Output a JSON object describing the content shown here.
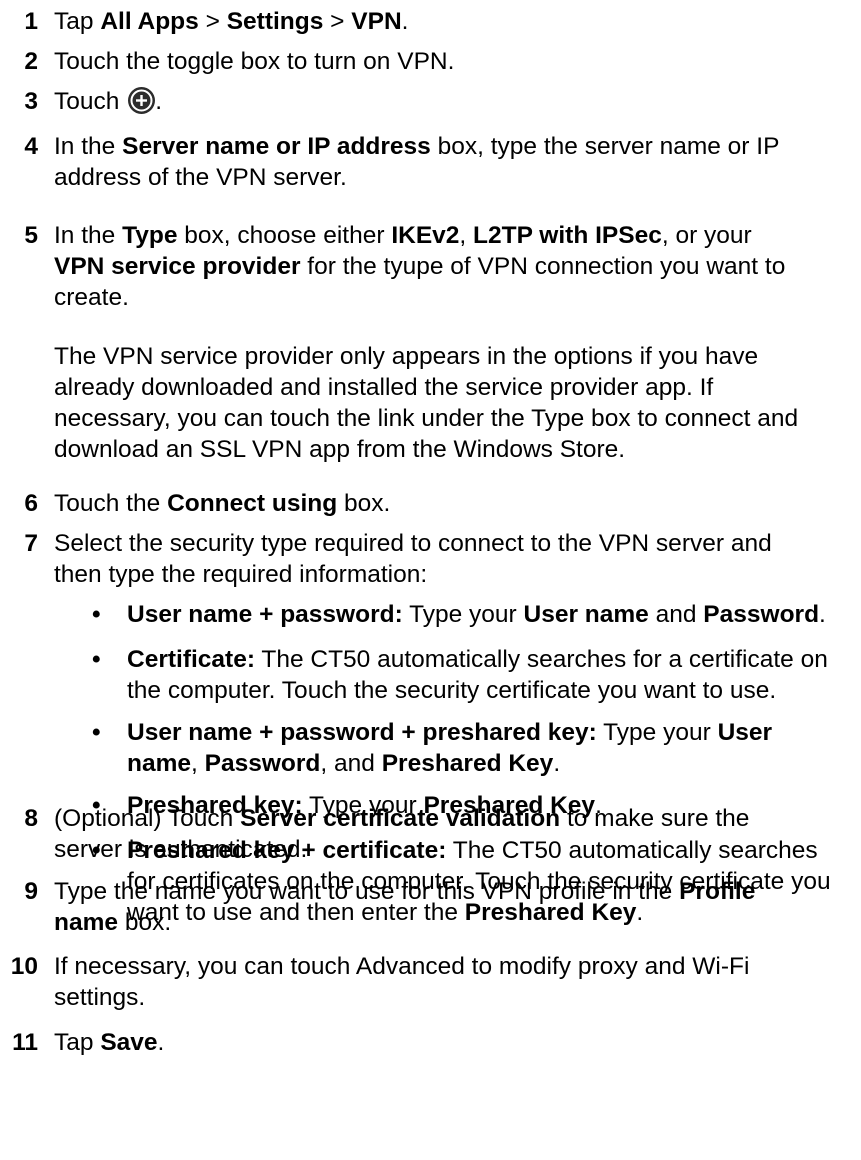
{
  "steps": [
    {
      "num": "1",
      "parts": [
        [
          "Tap ",
          0
        ],
        [
          "All Apps",
          1
        ],
        [
          " > ",
          0
        ],
        [
          "Settings",
          1
        ],
        [
          " > ",
          0
        ],
        [
          "VPN",
          1
        ],
        [
          ".",
          0
        ]
      ]
    },
    {
      "num": "2",
      "parts": [
        [
          "Touch the toggle box to turn on VPN.",
          0
        ]
      ]
    },
    {
      "num": "3",
      "before": "Touch ",
      "icon": "plus-circle-icon",
      "after": "."
    },
    {
      "num": "4",
      "lines": [
        [
          [
            "In the ",
            0
          ],
          [
            "Server name or IP address",
            1
          ],
          [
            " box, type the server name or IP",
            0
          ]
        ],
        [
          [
            "address of the VPN server.",
            0
          ]
        ]
      ]
    },
    {
      "num": "5",
      "lines": [
        [
          [
            "In the ",
            0
          ],
          [
            "Type",
            1
          ],
          [
            " box, choose either ",
            0
          ],
          [
            "IKEv2",
            1
          ],
          [
            ", ",
            0
          ],
          [
            "L2TP with IPSec",
            1
          ],
          [
            ", or your",
            0
          ]
        ],
        [
          [
            "VPN service provider",
            1
          ],
          [
            " for the tyupe of VPN connection you want to",
            0
          ]
        ],
        [
          [
            "create.",
            0
          ]
        ]
      ]
    },
    {
      "num": "",
      "note": true,
      "lines": [
        [
          [
            "The VPN service provider only appears in the options if you have",
            0
          ]
        ],
        [
          [
            "already downloaded and installed the service provider app. If",
            0
          ]
        ],
        [
          [
            "necessary, you can touch the link under the Type box to connect and",
            0
          ]
        ],
        [
          [
            "download an SSL VPN app from the Windows Store.",
            0
          ]
        ]
      ]
    },
    {
      "num": "6",
      "parts": [
        [
          "Touch the ",
          0
        ],
        [
          "Connect using",
          1
        ],
        [
          " box.",
          0
        ]
      ]
    },
    {
      "num": "7",
      "lines": [
        [
          [
            "Select the security type required to connect to the VPN server and",
            0
          ]
        ],
        [
          [
            "then type the required information:",
            0
          ]
        ]
      ]
    },
    {
      "num": "8",
      "lines": [
        [
          [
            "(Optional) Touch ",
            0
          ],
          [
            "Server certificate validation",
            1
          ],
          [
            " to make sure the",
            0
          ]
        ],
        [
          [
            "server is authenticated.",
            0
          ]
        ]
      ]
    },
    {
      "num": "9",
      "lines": [
        [
          [
            "Type the name you want to use for this VPN profile in the ",
            0
          ],
          [
            "Profile",
            1
          ]
        ],
        [
          [
            "name",
            1
          ],
          [
            " box.",
            0
          ]
        ]
      ]
    },
    {
      "num": "10",
      "lines": [
        [
          [
            "If necessary, you can touch Advanced to modify proxy and Wi-Fi",
            0
          ]
        ],
        [
          [
            "settings.",
            0
          ]
        ]
      ]
    },
    {
      "num": "11",
      "parts": [
        [
          "Tap ",
          0
        ],
        [
          "Save",
          1
        ],
        [
          ".",
          0
        ]
      ]
    }
  ],
  "bullets": [
    {
      "lines": [
        [
          [
            "User name + password:",
            1
          ],
          [
            " Type your ",
            0
          ],
          [
            "User name",
            1
          ],
          [
            " and ",
            0
          ],
          [
            "Password",
            1
          ],
          [
            ".",
            0
          ]
        ]
      ]
    },
    {
      "lines": [
        [
          [
            "Certificate:",
            1
          ],
          [
            " The CT50 automatically searches for a certificate on",
            0
          ]
        ],
        [
          [
            "the computer. Touch the security certificate you want to use.",
            0
          ]
        ]
      ]
    },
    {
      "lines": [
        [
          [
            "User name + password + preshared key:",
            1
          ],
          [
            " Type your ",
            0
          ],
          [
            "User",
            1
          ]
        ],
        [
          [
            "name",
            1
          ],
          [
            ", ",
            0
          ],
          [
            "Password",
            1
          ],
          [
            ", and ",
            0
          ],
          [
            "Preshared Key",
            1
          ],
          [
            ".",
            0
          ]
        ]
      ]
    },
    {
      "lines": [
        [
          [
            "Preshared key:",
            1
          ],
          [
            " Type your ",
            0
          ],
          [
            "Preshared Key",
            1
          ],
          [
            ".",
            0
          ]
        ]
      ]
    },
    {
      "lines": [
        [
          [
            "Preshared key + certificate:",
            1
          ],
          [
            " The CT50 automatically searches",
            0
          ]
        ],
        [
          [
            "for certificates on the computer. Touch the security certificate you",
            0
          ]
        ],
        [
          [
            "want to use and then enter the ",
            0
          ],
          [
            "Preshared Key",
            1
          ],
          [
            ".",
            0
          ]
        ]
      ]
    }
  ],
  "bullet_char": "•",
  "icon_color": "#2c2c2c"
}
